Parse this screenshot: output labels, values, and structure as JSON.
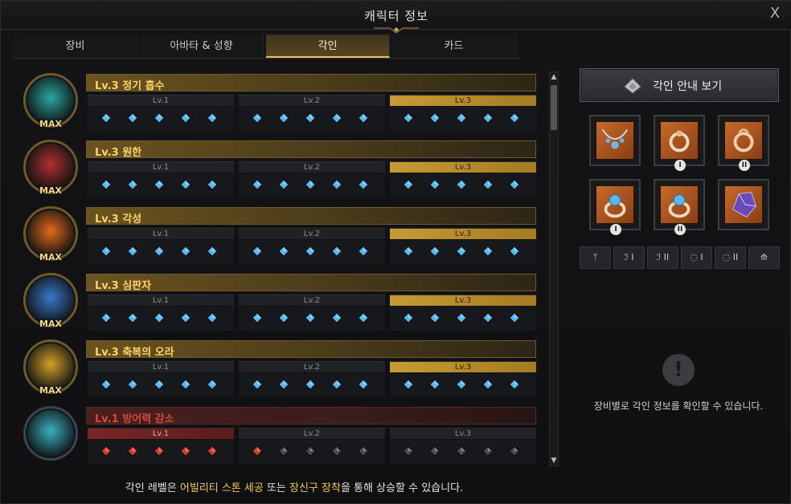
{
  "window": {
    "title": "캐릭터 정보",
    "close_label": "X"
  },
  "tabs": [
    {
      "label": "장비",
      "active": false
    },
    {
      "label": "아바타 & 성향",
      "active": false
    },
    {
      "label": "각인",
      "active": true
    },
    {
      "label": "카드",
      "active": false
    }
  ],
  "engravings": [
    {
      "title": "Lv.3 정기 흡수",
      "max": "MAX",
      "level": 3,
      "portrait_color": "#2aa8a0",
      "red": false
    },
    {
      "title": "Lv.3 원한",
      "max": "MAX",
      "level": 3,
      "portrait_color": "#b03030",
      "red": false
    },
    {
      "title": "Lv.3 각성",
      "max": "MAX",
      "level": 3,
      "portrait_color": "#e06a1c",
      "red": false
    },
    {
      "title": "Lv.3 심판자",
      "max": "MAX",
      "level": 3,
      "portrait_color": "#3a7ac8",
      "red": false
    },
    {
      "title": "Lv.3 축복의 오라",
      "max": "MAX",
      "level": 3,
      "portrait_color": "#d4a02a",
      "red": false
    },
    {
      "title": "Lv.1 방어력 감소",
      "max": "",
      "level": 1,
      "portrait_color": "#3ab0c0",
      "red": true
    }
  ],
  "level_labels": [
    "Lv.1",
    "Lv.2",
    "Lv.3"
  ],
  "footer": {
    "part1": "각인 레벨은 ",
    "hl1": "어빌리티 스톤 세공",
    "part2": " 또는 ",
    "hl2": "장신구 장착",
    "part3": "을 통해 상승할 수 있습니다."
  },
  "side": {
    "guide_label": "각인 안내 보기",
    "slots": [
      {
        "name": "necklace",
        "badge": ""
      },
      {
        "name": "earring-1",
        "badge": "I"
      },
      {
        "name": "earring-2",
        "badge": "II"
      },
      {
        "name": "ring-1",
        "badge": "I"
      },
      {
        "name": "ring-2",
        "badge": "II"
      },
      {
        "name": "ability-stone",
        "badge": ""
      }
    ],
    "filters": [
      "ᛘ",
      "ℐ I",
      "ℐ II",
      "◌ I",
      "◌ II",
      "⟰"
    ],
    "info_icon": "!",
    "info_text": "장비별로 각인 정보를 확인할 수 있습니다."
  },
  "colors": {
    "gem_blue": "#5ab8f0",
    "gem_red": "#d04030",
    "gem_off": "#4a4c50",
    "accent_gold": "#f2c95a"
  }
}
